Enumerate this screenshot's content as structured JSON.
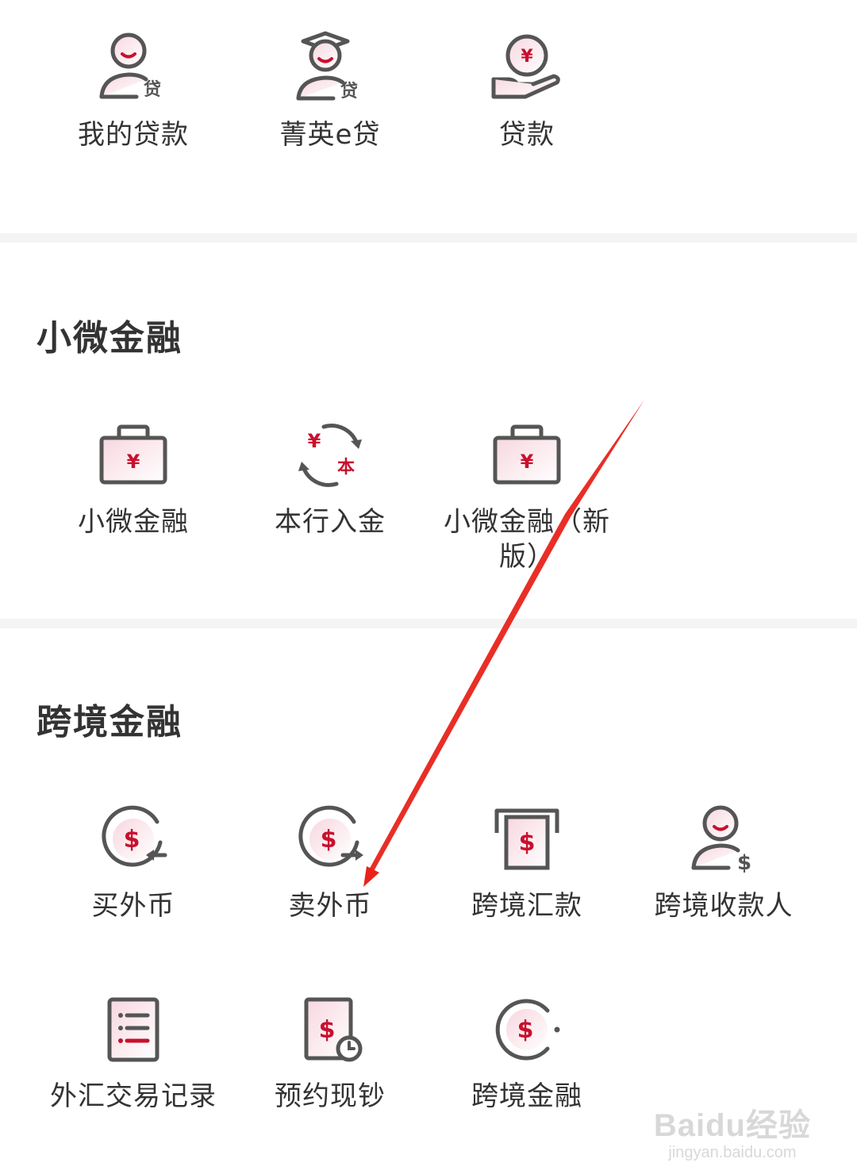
{
  "loans": {
    "items": [
      {
        "label": "我的贷款",
        "icon": "person-loan-icon"
      },
      {
        "label": "菁英e贷",
        "icon": "graduate-loan-icon"
      },
      {
        "label": "贷款",
        "icon": "hand-yuan-icon"
      }
    ]
  },
  "micro_finance": {
    "title": "小微金融",
    "items": [
      {
        "label": "小微金融",
        "icon": "briefcase-yuan-icon"
      },
      {
        "label": "本行入金",
        "icon": "exchange-yuan-icon"
      },
      {
        "label": "小微金融（新版）",
        "icon": "briefcase-yuan-icon"
      }
    ]
  },
  "cross_border": {
    "title": "跨境金融",
    "items": [
      {
        "label": "买外币",
        "icon": "buy-dollar-icon"
      },
      {
        "label": "卖外币",
        "icon": "sell-dollar-icon"
      },
      {
        "label": "跨境汇款",
        "icon": "atm-dollar-icon"
      },
      {
        "label": "跨境收款人",
        "icon": "person-dollar-icon"
      },
      {
        "label": "外汇交易记录",
        "icon": "list-record-icon"
      },
      {
        "label": "预约现钞",
        "icon": "dollar-clock-icon"
      },
      {
        "label": "跨境金融",
        "icon": "dollar-circle-icon"
      }
    ]
  },
  "colors": {
    "accent": "#c8102e",
    "icon_gray": "#555555",
    "annotation_arrow": "#e8231a"
  },
  "watermark": {
    "main": "Baidu经验",
    "sub": "jingyan.baidu.com"
  }
}
